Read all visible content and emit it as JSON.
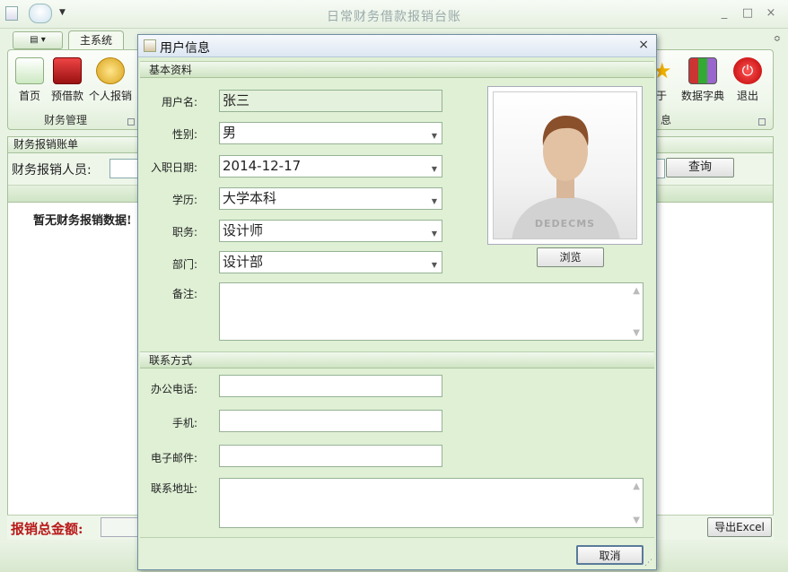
{
  "window": {
    "title": "日常财务借款报销台账",
    "tab_main": "主系统"
  },
  "ribbon": {
    "buttons_left": [
      {
        "label": "首页",
        "icon": "home-icon"
      },
      {
        "label": "预借款",
        "icon": "briefcase-icon"
      },
      {
        "label": "个人报销",
        "icon": "coins-icon"
      }
    ],
    "group_left_label": "财务管理",
    "buttons_right": [
      {
        "label": "于",
        "icon": "star-icon"
      },
      {
        "label": "数据字典",
        "icon": "books-icon"
      },
      {
        "label": "退出",
        "icon": "power-icon"
      }
    ],
    "group_right_label": "息"
  },
  "list_panel": {
    "header": "财务报销账单",
    "filter_label": "财务报销人员:",
    "search_button": "查询",
    "empty_text": "暂无财务报销数据!"
  },
  "footer": {
    "total_label": "报销总金额:",
    "export_button": "导出Excel"
  },
  "dialog": {
    "title": "用户信息",
    "section_basic": "基本资料",
    "fields": {
      "username_label": "用户名:",
      "username_value": "张三",
      "gender_label": "性别:",
      "gender_value": "男",
      "hire_date_label": "入职日期:",
      "hire_date_value": "2014-12-17",
      "education_label": "学历:",
      "education_value": "大学本科",
      "position_label": "职务:",
      "position_value": "设计师",
      "department_label": "部门:",
      "department_value": "设计部",
      "remark_label": "备注:"
    },
    "photo_caption": "DEDECMS",
    "browse_button": "浏览",
    "section_contact": "联系方式",
    "contact": {
      "office_phone_label": "办公电话:",
      "mobile_label": "手机:",
      "email_label": "电子邮件:",
      "address_label": "联系地址:"
    },
    "cancel_button": "取消"
  }
}
